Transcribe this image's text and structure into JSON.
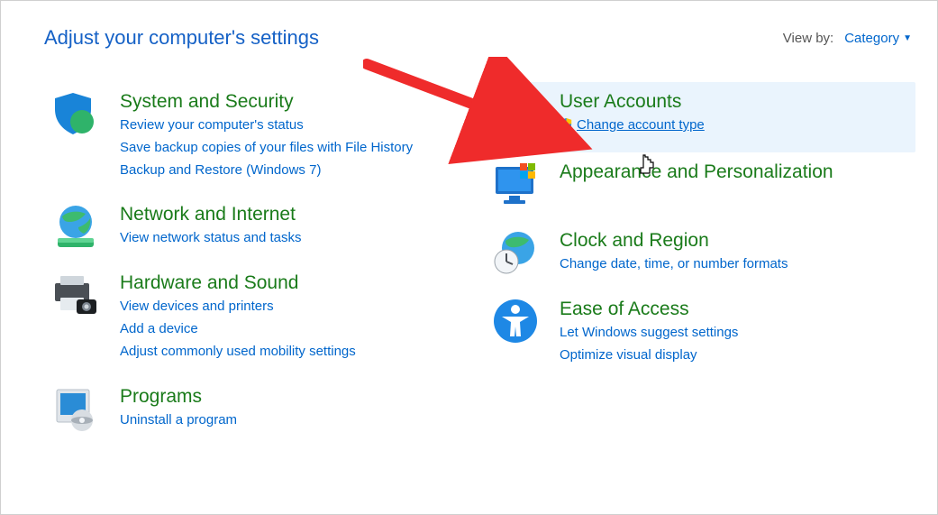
{
  "header": {
    "title": "Adjust your computer's settings",
    "viewby_label": "View by:",
    "viewby_value": "Category"
  },
  "left": [
    {
      "title": "System and Security",
      "links": [
        "Review your computer's status",
        "Save backup copies of your files with File History",
        "Backup and Restore (Windows 7)"
      ]
    },
    {
      "title": "Network and Internet",
      "links": [
        "View network status and tasks"
      ]
    },
    {
      "title": "Hardware and Sound",
      "links": [
        "View devices and printers",
        "Add a device",
        "Adjust commonly used mobility settings"
      ]
    },
    {
      "title": "Programs",
      "links": [
        "Uninstall a program"
      ]
    }
  ],
  "right": [
    {
      "title": "User Accounts",
      "links": [
        "Change account type"
      ]
    },
    {
      "title": "Appearance and Personalization",
      "links": []
    },
    {
      "title": "Clock and Region",
      "links": [
        "Change date, time, or number formats"
      ]
    },
    {
      "title": "Ease of Access",
      "links": [
        "Let Windows suggest settings",
        "Optimize visual display"
      ]
    }
  ]
}
